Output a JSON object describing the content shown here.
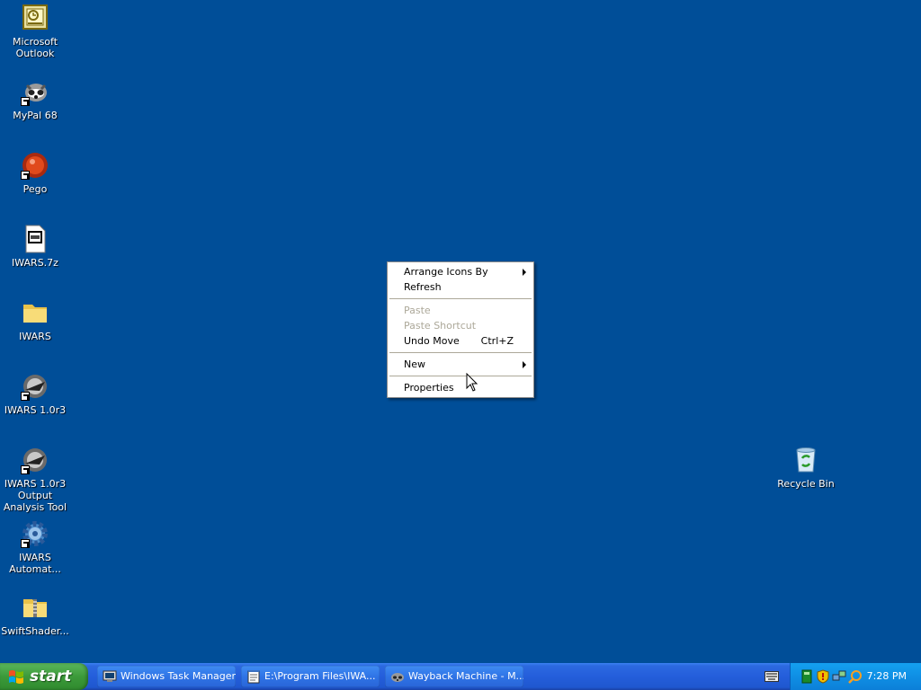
{
  "desktop_icons": [
    {
      "label": "Microsoft\nOutlook",
      "icon": "outlook-icon"
    },
    {
      "label": "MyPal 68",
      "icon": "mypal-raccoon-icon"
    },
    {
      "label": "Pego",
      "icon": "pego-icon"
    },
    {
      "label": "IWARS.7z",
      "icon": "archive-file-icon"
    },
    {
      "label": "IWARS",
      "icon": "folder-icon"
    },
    {
      "label": "IWARS 1.0r3",
      "icon": "iwars-icon"
    },
    {
      "label": "IWARS 1.0r3\nOutput\nAnalysis Tool",
      "icon": "iwars-analysis-icon"
    },
    {
      "label": "IWARS\nAutomat...",
      "icon": "gear-icon"
    },
    {
      "label": "SwiftShader...",
      "icon": "zip-folder-icon"
    },
    {
      "label": "Recycle Bin",
      "icon": "recycle-bin-icon"
    }
  ],
  "context_menu": {
    "arrange_icons_by": "Arrange Icons By",
    "refresh": "Refresh",
    "paste": "Paste",
    "paste_shortcut": "Paste Shortcut",
    "undo_move": "Undo Move",
    "undo_move_shortcut": "Ctrl+Z",
    "new": "New",
    "properties": "Properties"
  },
  "taskbar": {
    "start_label": "start",
    "tasks": [
      {
        "label": "Windows Task Manager"
      },
      {
        "label": "E:\\Program Files\\IWA..."
      },
      {
        "label": "Wayback Machine - M..."
      }
    ],
    "clock": "7:28 PM"
  },
  "colors": {
    "desktop": "#004e98",
    "taskbar": "#245edb",
    "start_button": "#3c9a3a",
    "tray": "#0f8fe4",
    "disabled_text": "#aca899"
  }
}
